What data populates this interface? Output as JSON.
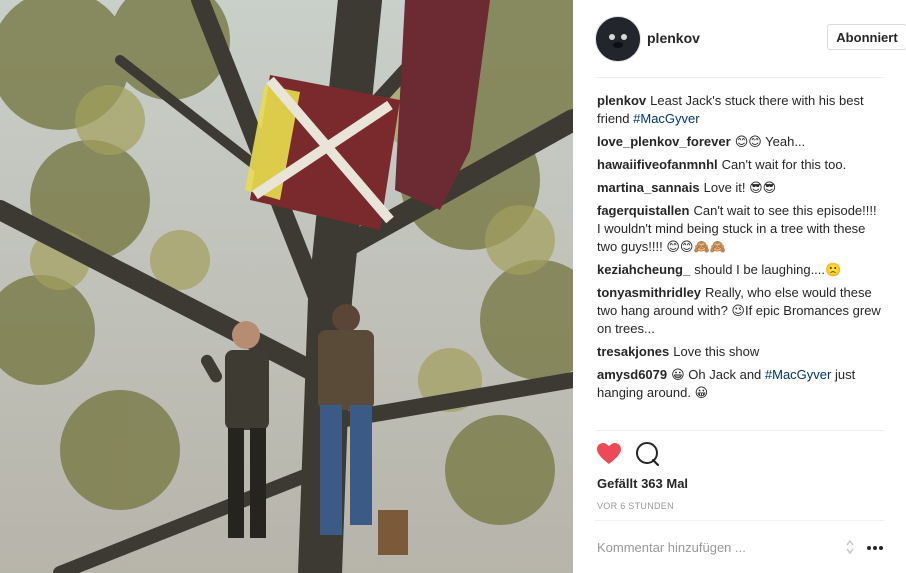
{
  "post": {
    "author": "plenkov",
    "follow_label": "Abonniert",
    "photo_alt": "",
    "likes": "Gefällt 363 Mal",
    "time": "VOR 6 STUNDEN",
    "add_comment_placeholder": "Kommentar hinzufügen ..."
  },
  "comments": [
    {
      "user": "plenkov",
      "text": "Least Jack's stuck there with his best friend ",
      "tag": "#MacGyver",
      "after": ""
    },
    {
      "user": "love_plenkov_forever",
      "text": "😊😊 Yeah...",
      "tag": "",
      "after": ""
    },
    {
      "user": "hawaiifiveofanmnhl",
      "text": "Can't wait for this too.",
      "tag": "",
      "after": ""
    },
    {
      "user": "martina_sannais",
      "text": "Love it! 😎😎",
      "tag": "",
      "after": ""
    },
    {
      "user": "fagerquistallen",
      "text": "Can't wait to see this episode!!!! I wouldn't mind being stuck in a tree with these two guys!!!! 😊😊🙈🙈",
      "tag": "",
      "after": ""
    },
    {
      "user": "keziahcheung_",
      "text": "should I be laughing....🙁",
      "tag": "",
      "after": ""
    },
    {
      "user": "tonyasmithridley",
      "text": "Really, who else would these two hang around with? 😉If epic Bromances grew on trees...",
      "tag": "",
      "after": ""
    },
    {
      "user": "tresakjones",
      "text": "Love this show",
      "tag": "",
      "after": ""
    },
    {
      "user": "amysd6079",
      "text": "😀 Oh Jack and ",
      "tag": "#MacGyver",
      "after": " just hanging around. 😀"
    }
  ],
  "icons": {
    "like": "heart-icon",
    "comment": "comment-bubble-icon",
    "more": "more-dots-icon",
    "scroll": "scroll-arrows-icon"
  },
  "colors": {
    "heart": "#ed4956",
    "hashtag": "#003569",
    "muted": "#999999"
  }
}
